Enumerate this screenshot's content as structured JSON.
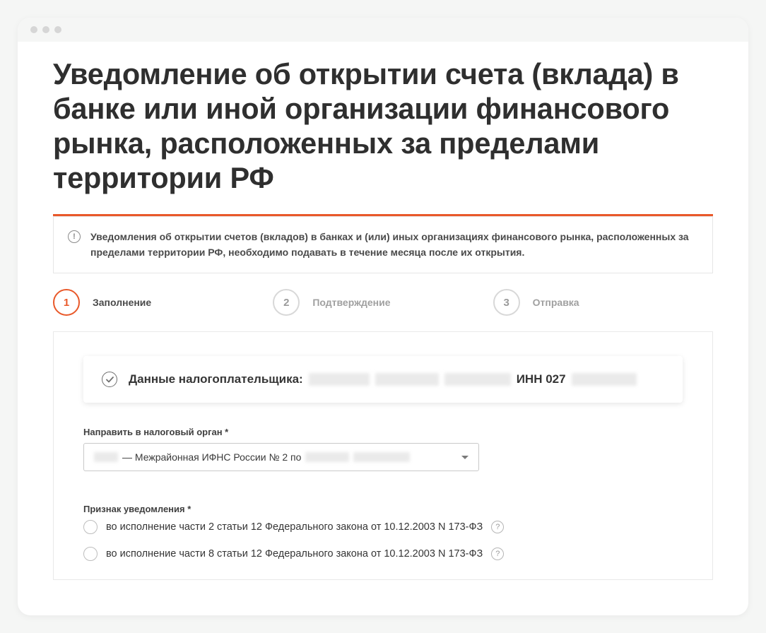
{
  "page": {
    "title": "Уведомление об открытии счета (вклада) в банке или иной организации финансового рынка, расположенных за пределами территории РФ"
  },
  "info": {
    "text": "Уведомления об открытии счетов (вкладов) в банках и (или) иных организациях финансового рынка, расположенных за пределами территории РФ, необходимо подавать в течение месяца после их открытия."
  },
  "steps": [
    {
      "num": "1",
      "label": "Заполнение",
      "active": true
    },
    {
      "num": "2",
      "label": "Подтверждение",
      "active": false
    },
    {
      "num": "3",
      "label": "Отправка",
      "active": false
    }
  ],
  "summary": {
    "label": "Данные налогоплательщика:",
    "inn_prefix": "ИНН 027"
  },
  "tax_authority": {
    "label": "Направить в налоговый орган *",
    "value_mid": " — Межрайонная ИФНС России № 2 по "
  },
  "notification_type": {
    "label": "Признак уведомления *",
    "options": [
      "во исполнение части 2 статьи 12 Федерального закона от 10.12.2003 N 173-ФЗ",
      "во исполнение части 8 статьи 12 Федерального закона от 10.12.2003 N 173-ФЗ"
    ]
  }
}
